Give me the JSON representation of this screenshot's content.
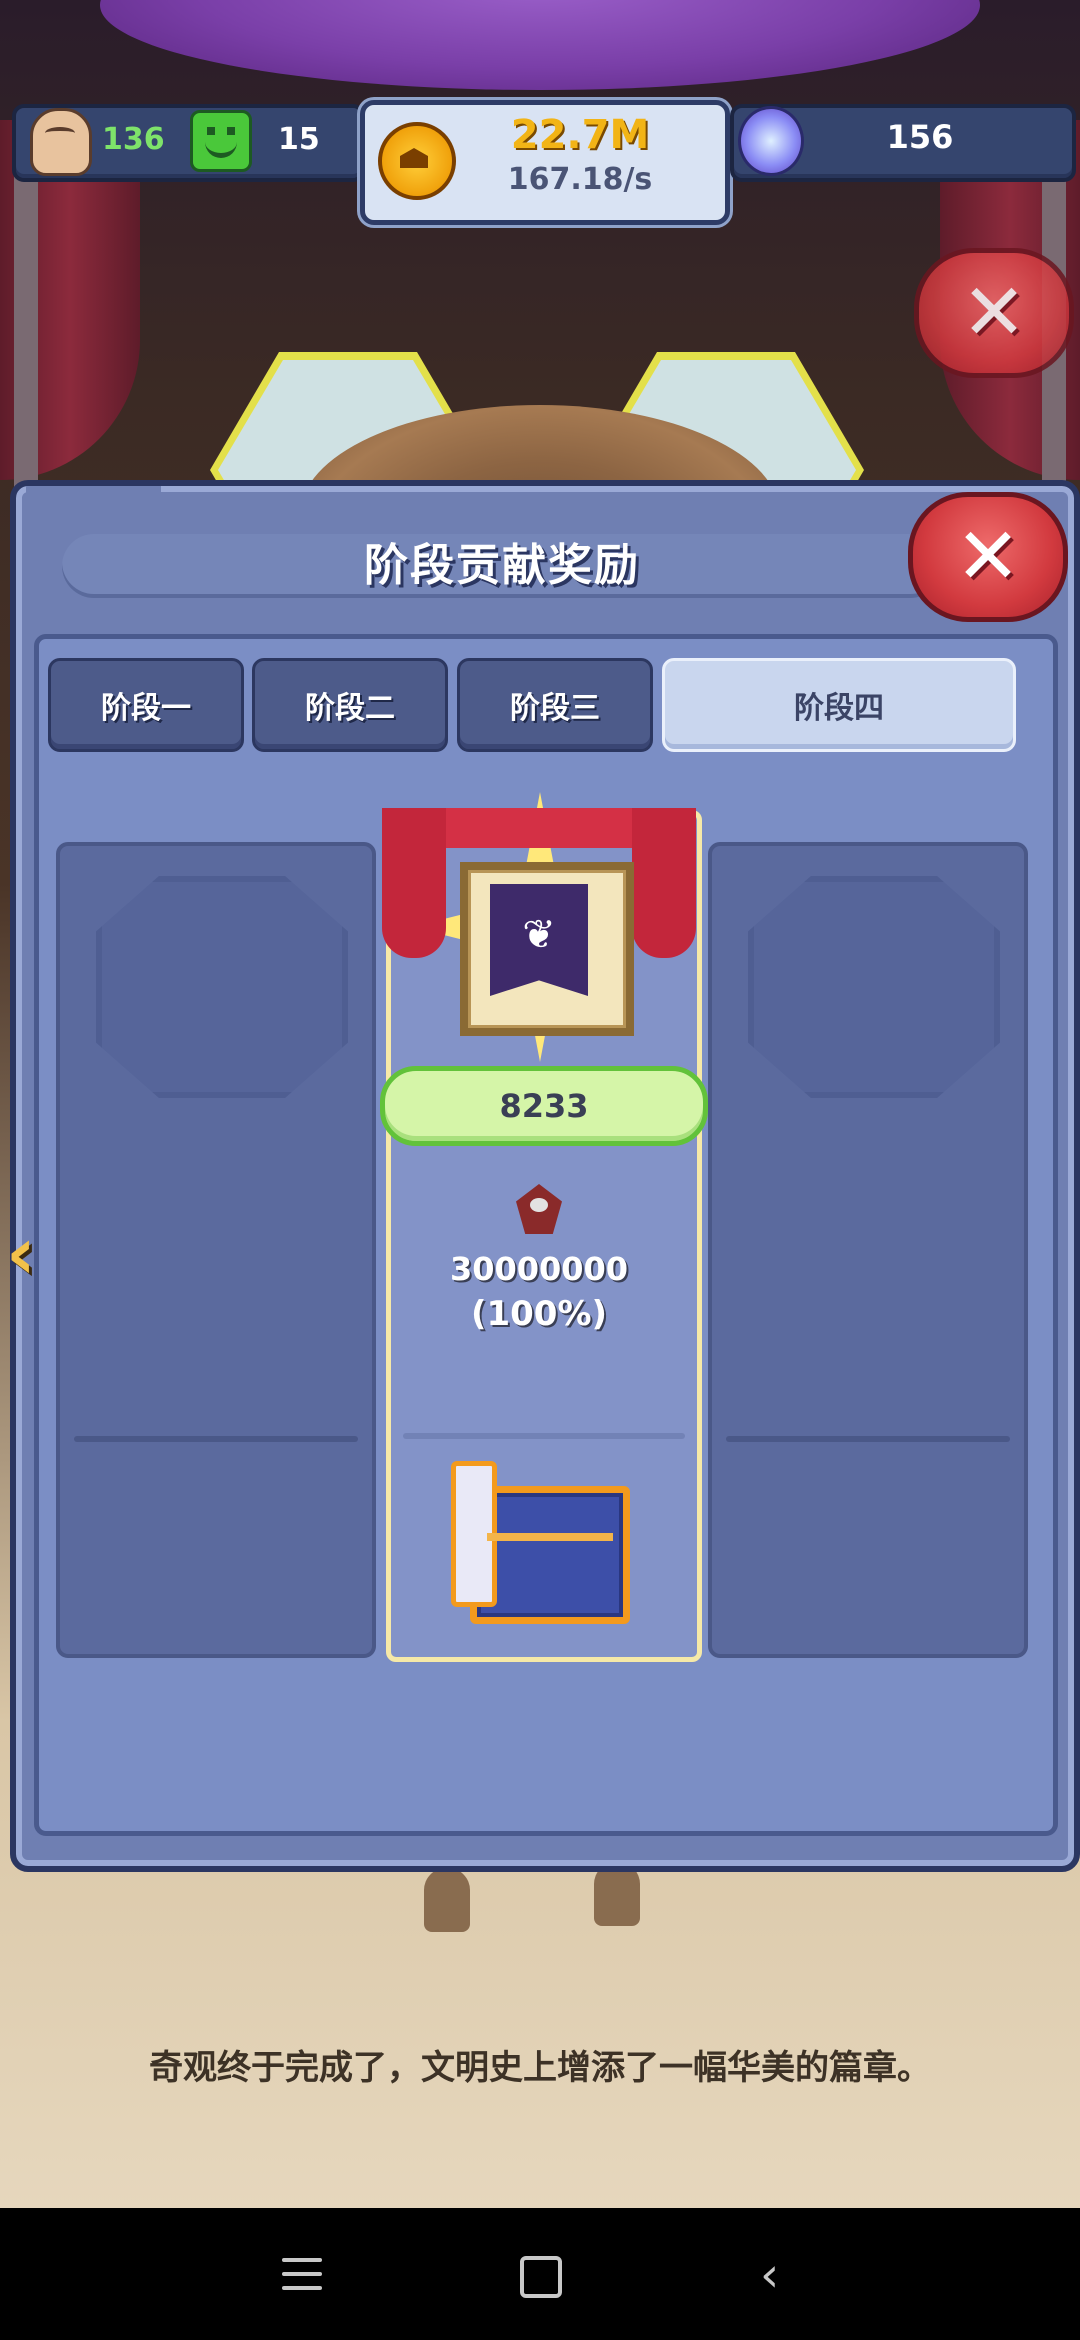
{
  "hud": {
    "population": "136",
    "happiness": "15",
    "gold": "22.7M",
    "gold_rate": "167.18/s",
    "gems": "156"
  },
  "dialog": {
    "title": "阶段贡献奖励",
    "close_label": "✕",
    "tabs": [
      {
        "label": "阶段一",
        "selected": false
      },
      {
        "label": "阶段二",
        "selected": false
      },
      {
        "label": "阶段三",
        "selected": false
      },
      {
        "label": "阶段四",
        "selected": true
      }
    ],
    "reward_card": {
      "score": "8233",
      "amount": "30000000",
      "percent": "(100%)"
    }
  },
  "story_text": "奇观终于完成了，文明史上增添了一幅华美的篇章。",
  "colors": {
    "panel": "#6f7fb2",
    "tab_selected": "#c9d6ee",
    "score_pill": "#d5f5a8",
    "close_button": "#d23a3f",
    "gold_text": "#f2b416"
  },
  "icons": [
    "person-icon",
    "smiley-icon",
    "gold-coin-icon",
    "gem-icon",
    "banner-emblem-icon",
    "resource-icon",
    "treasure-chest-icon",
    "close-icon",
    "back-arrow-icon",
    "nav-menu-icon",
    "nav-home-icon",
    "nav-back-icon"
  ]
}
